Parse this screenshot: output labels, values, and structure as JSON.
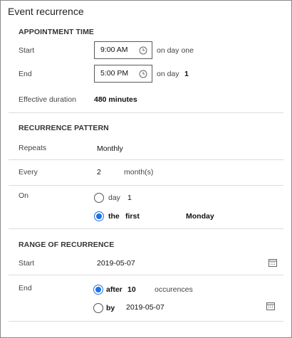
{
  "window": {
    "title": "Event recurrence"
  },
  "appointment": {
    "heading": "APPOINTMENT TIME",
    "start_label": "Start",
    "start_time": "9:00 AM",
    "start_suffix": "on day one",
    "end_label": "End",
    "end_time": "5:00 PM",
    "end_suffix": "on day",
    "end_day": "1",
    "duration_label": "Effective duration",
    "duration_value": "480 minutes"
  },
  "pattern": {
    "heading": "RECURRENCE PATTERN",
    "repeats_label": "Repeats",
    "repeats_value": "Monthly",
    "every_label": "Every",
    "every_value": "2",
    "every_unit": "month(s)",
    "on_label": "On",
    "option_day_label": "day",
    "option_day_value": "1",
    "option_the_label": "the",
    "option_the_ordinal": "first",
    "option_the_weekday": "Monday",
    "selected": "the"
  },
  "range": {
    "heading": "RANGE OF RECURRENCE",
    "start_label": "Start",
    "start_date": "2019-05-07",
    "end_label": "End",
    "after_label": "after",
    "after_count": "10",
    "after_unit": "occurences",
    "by_label": "by",
    "by_date": "2019-05-07",
    "selected": "after"
  },
  "colors": {
    "accent": "#1a73e8",
    "border": "#8a8a8a",
    "divider": "#dcdcdc"
  },
  "icons": {
    "clock": "clock-icon",
    "calendar": "calendar-icon"
  }
}
